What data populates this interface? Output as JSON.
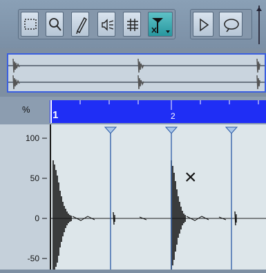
{
  "toolbar": {
    "tools": [
      {
        "name": "range-selection-tool",
        "icon": "dashed-rect-icon"
      },
      {
        "name": "zoom-tool",
        "icon": "magnifier-icon"
      },
      {
        "name": "draw-tool",
        "icon": "pencil-icon"
      },
      {
        "name": "play-tool",
        "icon": "speaker-icon"
      },
      {
        "name": "scrub-tool",
        "icon": "scrub-icon"
      },
      {
        "name": "hitpoint-tool",
        "icon": "hitpoint-icon",
        "active": true
      }
    ],
    "transport": [
      {
        "name": "play-button",
        "icon": "play-icon"
      },
      {
        "name": "loop-button",
        "icon": "loop-icon"
      }
    ]
  },
  "ruler": {
    "corner_label": "%",
    "bar_numbers": [
      "1",
      "2"
    ]
  },
  "scale": {
    "labels": [
      "100",
      "50",
      "0",
      "-50"
    ]
  },
  "editor": {
    "cursor_glyph": "×"
  },
  "colors": {
    "ruler_blue": "#1f2ef5",
    "overview_border": "#3a5fe0",
    "active_tool": "#2e9ea6",
    "marker_line": "#2a5aa6"
  }
}
